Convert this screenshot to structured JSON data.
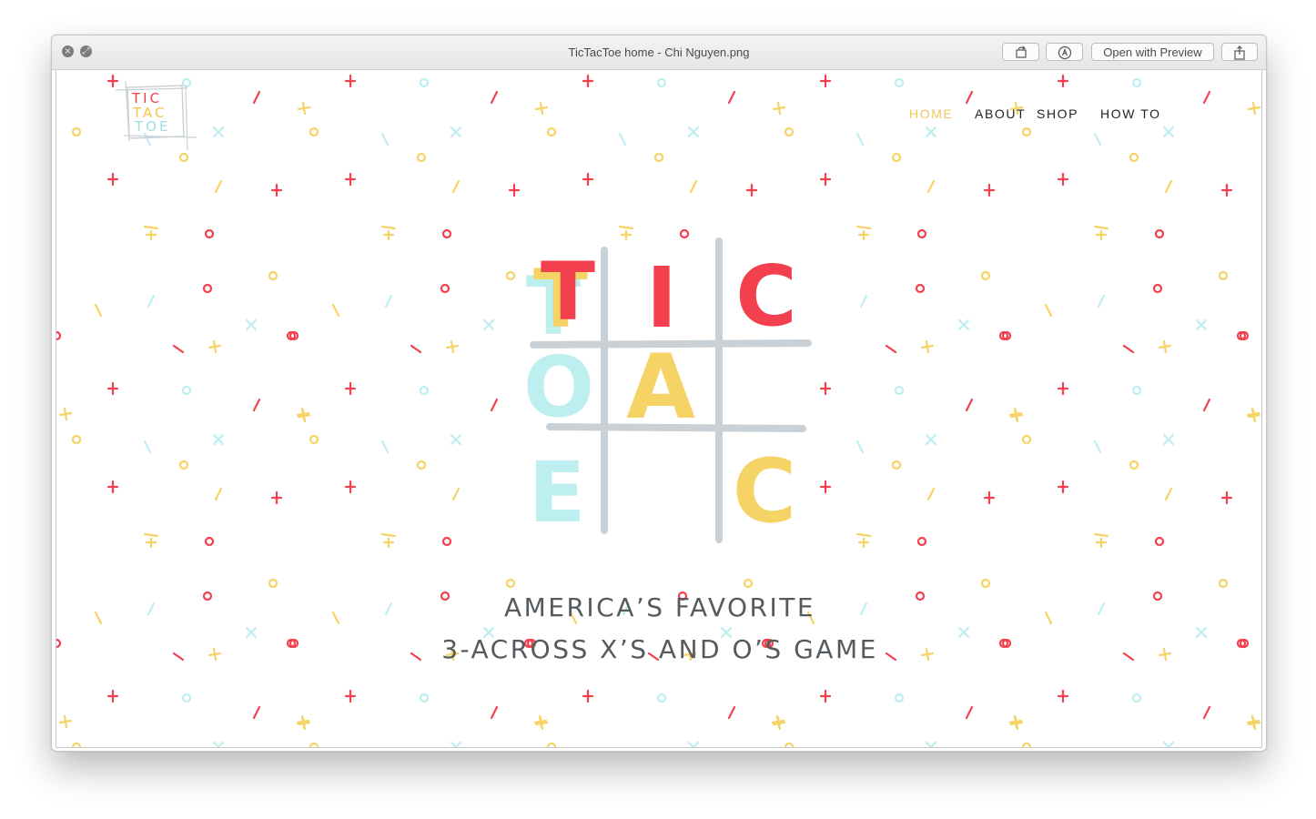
{
  "window": {
    "title": "TicTacToe home - Chi Nguyen.png",
    "toolbar": {
      "rotate_icon": "rotate-icon",
      "markup_icon": "markup-pen-icon",
      "open_with_preview_label": "Open with Preview",
      "share_icon": "share-icon"
    },
    "controls": {
      "close_icon": "close-icon",
      "fullscreen_icon": "fullscreen-icon"
    }
  },
  "site": {
    "logo": {
      "line1": "TIC",
      "line2": "TAC",
      "line3": "TOE"
    },
    "nav": {
      "home": "HOME",
      "about": "ABOUT",
      "shop": "SHOP",
      "how_to": "HOW TO"
    },
    "hero": {
      "letters": [
        "T",
        "I",
        "C",
        "T",
        "A",
        "C",
        "T",
        "O",
        "E"
      ],
      "tagline_line1": "AMERICA’S FAVORITE",
      "tagline_line2": "3-ACROSS X’S AND O’S GAME"
    }
  },
  "colors": {
    "red": "#f2404f",
    "yellow": "#f6d365",
    "teal": "#bdeef0",
    "grid": "#c9d1d6",
    "nav_active": "#f2c65a",
    "text": "#555a5f"
  }
}
